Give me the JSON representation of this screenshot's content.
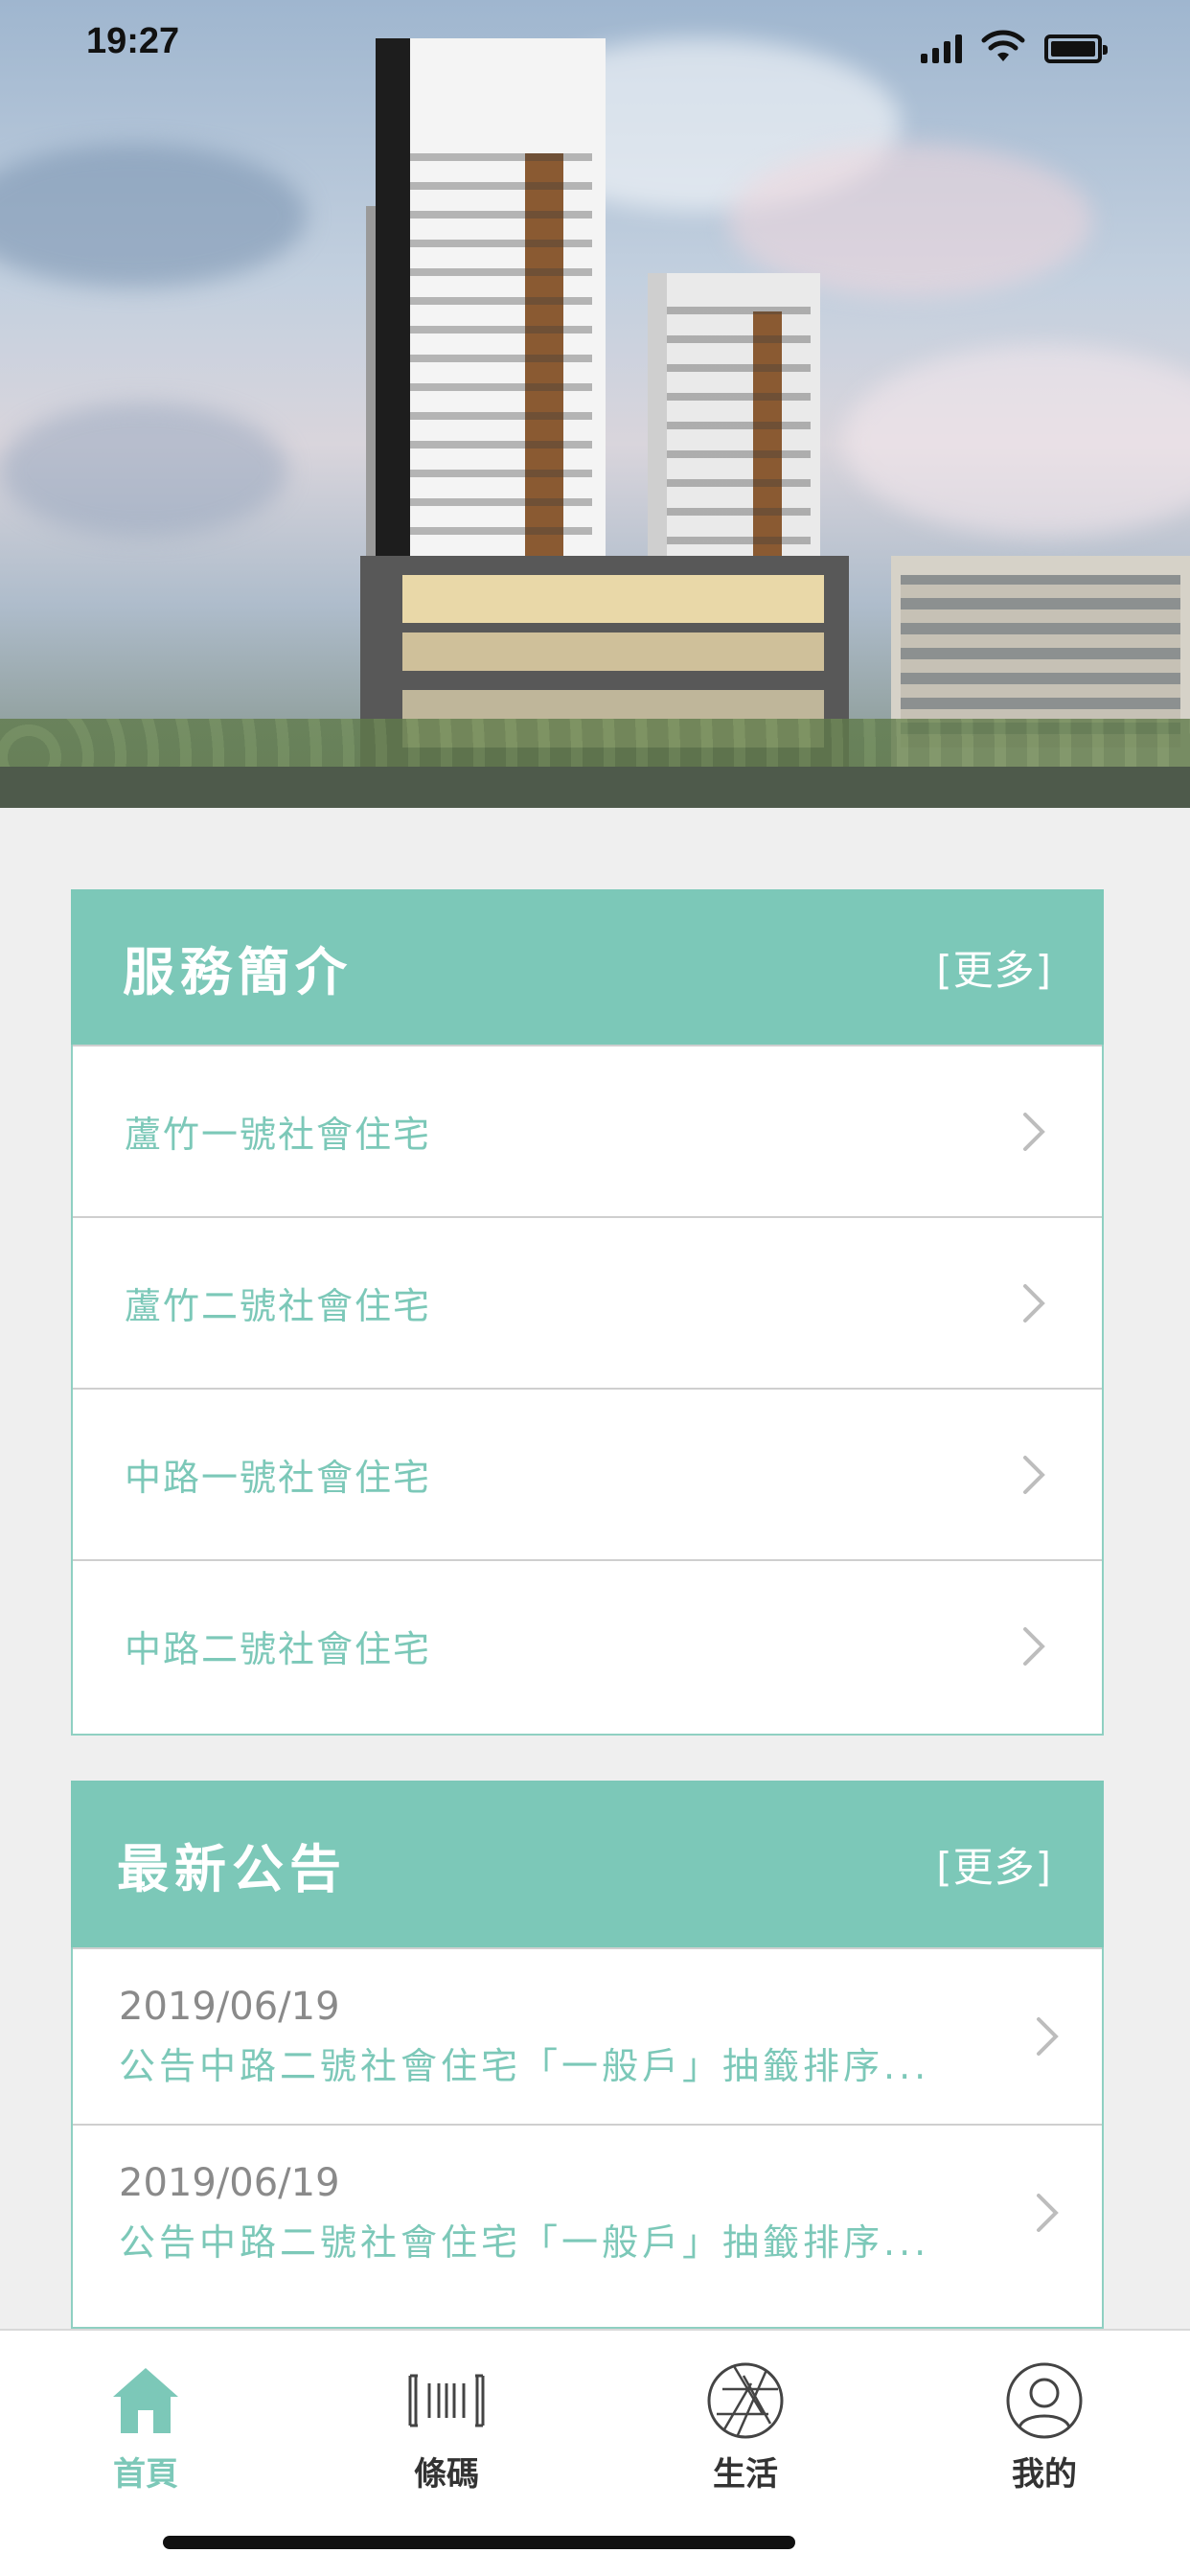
{
  "status_bar": {
    "time": "19:27",
    "icons": [
      "signal-icon",
      "wifi-icon",
      "battery-icon"
    ]
  },
  "hero": {
    "image": "apartment-building-rendering"
  },
  "services": {
    "title": "服務簡介",
    "more": "[更多]",
    "items": [
      {
        "label": "蘆竹一號社會住宅"
      },
      {
        "label": "蘆竹二號社會住宅"
      },
      {
        "label": "中路一號社會住宅"
      },
      {
        "label": "中路二號社會住宅"
      }
    ]
  },
  "news": {
    "title": "最新公告",
    "more": "[更多]",
    "items": [
      {
        "date": "2019/06/19",
        "title": "公告中路二號社會住宅「一般戶」抽籤排序..."
      },
      {
        "date": "2019/06/19",
        "title": "公告中路二號社會住宅「一般戶」抽籤排序..."
      }
    ]
  },
  "tab_bar": {
    "tabs": [
      {
        "label": "首頁",
        "icon": "home-icon",
        "active": true
      },
      {
        "label": "條碼",
        "icon": "barcode-icon",
        "active": false
      },
      {
        "label": "生活",
        "icon": "aperture-icon",
        "active": false
      },
      {
        "label": "我的",
        "icon": "user-icon",
        "active": false
      }
    ]
  },
  "colors": {
    "accent": "#7cc8b8",
    "background": "#efefef",
    "divider": "#cfcfcf"
  }
}
